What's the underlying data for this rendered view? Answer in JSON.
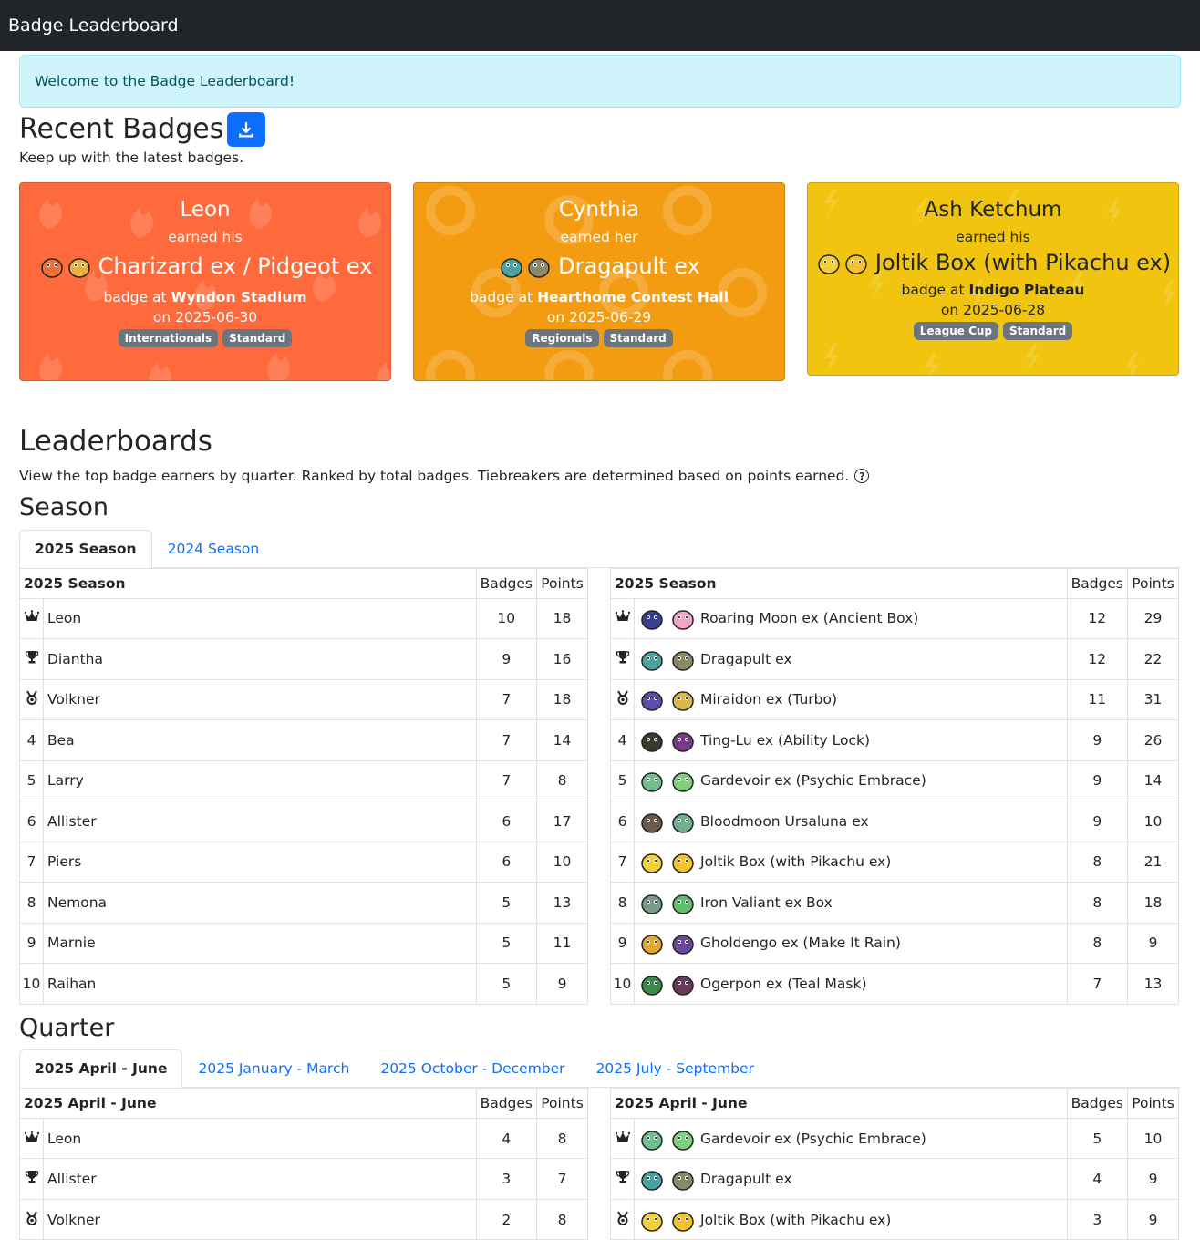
{
  "navbar": {
    "brand": "Badge Leaderboard"
  },
  "alert": {
    "text": "Welcome to the Badge Leaderboard!"
  },
  "recent": {
    "title": "Recent Badges",
    "subtitle": "Keep up with the latest badges.",
    "cards": [
      {
        "name": "Leon",
        "earned": "earned his",
        "deck": "Charizard ex / Pidgeot ex",
        "venue_prefix": "badge at",
        "venue": "Wyndon Stadium",
        "date": "on 2025-06-30",
        "tags": [
          "Internationals",
          "Standard"
        ],
        "color": "#ff6a3d"
      },
      {
        "name": "Cynthia",
        "earned": "earned her",
        "deck": "Dragapult ex",
        "venue_prefix": "badge at",
        "venue": "Hearthome Contest Hall",
        "date": "on 2025-06-29",
        "tags": [
          "Regionals",
          "Standard"
        ],
        "color": "#f39c12"
      },
      {
        "name": "Ash Ketchum",
        "earned": "earned his",
        "deck": "Joltik Box (with Pikachu ex)",
        "venue_prefix": "badge at",
        "venue": "Indigo Plateau",
        "date": "on 2025-06-28",
        "tags": [
          "League Cup",
          "Standard"
        ],
        "color": "#f1c40f"
      }
    ]
  },
  "leaderboards": {
    "title": "Leaderboards",
    "description": "View the top badge earners by quarter. Ranked by total badges. Tiebreakers are determined based on points earned.",
    "season": {
      "title": "Season",
      "tabs": [
        "2025 Season",
        "2024 Season"
      ],
      "player_table": {
        "header": "2025 Season",
        "col_badges": "Badges",
        "col_points": "Points",
        "rows": [
          {
            "rank": "crown",
            "name": "Leon",
            "badges": "10",
            "points": "18"
          },
          {
            "rank": "trophy",
            "name": "Diantha",
            "badges": "9",
            "points": "16"
          },
          {
            "rank": "medal",
            "name": "Volkner",
            "badges": "7",
            "points": "18"
          },
          {
            "rank": "4",
            "name": "Bea",
            "badges": "7",
            "points": "14"
          },
          {
            "rank": "5",
            "name": "Larry",
            "badges": "7",
            "points": "8"
          },
          {
            "rank": "6",
            "name": "Allister",
            "badges": "6",
            "points": "17"
          },
          {
            "rank": "7",
            "name": "Piers",
            "badges": "6",
            "points": "10"
          },
          {
            "rank": "8",
            "name": "Nemona",
            "badges": "5",
            "points": "13"
          },
          {
            "rank": "9",
            "name": "Marnie",
            "badges": "5",
            "points": "11"
          },
          {
            "rank": "10",
            "name": "Raihan",
            "badges": "5",
            "points": "9"
          }
        ]
      },
      "deck_table": {
        "header": "2025 Season",
        "col_badges": "Badges",
        "col_points": "Points",
        "rows": [
          {
            "rank": "crown",
            "name": "Roaring Moon ex (Ancient Box)",
            "badges": "12",
            "points": "29",
            "sprites": [
              "#3b3f8f",
              "#f3a6c8"
            ]
          },
          {
            "rank": "trophy",
            "name": "Dragapult ex",
            "badges": "12",
            "points": "22",
            "sprites": [
              "#4aa3a0",
              "#8a8a6a"
            ]
          },
          {
            "rank": "medal",
            "name": "Miraidon ex (Turbo)",
            "badges": "11",
            "points": "31",
            "sprites": [
              "#5a4fb0",
              "#d8b84a"
            ]
          },
          {
            "rank": "4",
            "name": "Ting-Lu ex (Ability Lock)",
            "badges": "9",
            "points": "26",
            "sprites": [
              "#3c3a2c",
              "#7a3a8a"
            ]
          },
          {
            "rank": "5",
            "name": "Gardevoir ex (Psychic Embrace)",
            "badges": "9",
            "points": "14",
            "sprites": [
              "#6fbf8f",
              "#7fcf7f"
            ]
          },
          {
            "rank": "6",
            "name": "Bloodmoon Ursaluna ex",
            "badges": "9",
            "points": "10",
            "sprites": [
              "#6b5a4a",
              "#6fb08f"
            ]
          },
          {
            "rank": "7",
            "name": "Joltik Box (with Pikachu ex)",
            "badges": "8",
            "points": "21",
            "sprites": [
              "#f2d03b",
              "#f2c230"
            ]
          },
          {
            "rank": "8",
            "name": "Iron Valiant ex Box",
            "badges": "8",
            "points": "18",
            "sprites": [
              "#7a9a8a",
              "#5fbf6f"
            ]
          },
          {
            "rank": "9",
            "name": "Gholdengo ex (Make It Rain)",
            "badges": "8",
            "points": "9",
            "sprites": [
              "#e0a830",
              "#6a4aa0"
            ]
          },
          {
            "rank": "10",
            "name": "Ogerpon ex (Teal Mask)",
            "badges": "7",
            "points": "13",
            "sprites": [
              "#3a8a4a",
              "#6a3a5a"
            ]
          }
        ]
      }
    },
    "quarter": {
      "title": "Quarter",
      "tabs": [
        "2025 April - June",
        "2025 January - March",
        "2025 October - December",
        "2025 July - September"
      ],
      "player_table": {
        "header": "2025 April - June",
        "col_badges": "Badges",
        "col_points": "Points",
        "rows": [
          {
            "rank": "crown",
            "name": "Leon",
            "badges": "4",
            "points": "8"
          },
          {
            "rank": "trophy",
            "name": "Allister",
            "badges": "3",
            "points": "7"
          },
          {
            "rank": "medal",
            "name": "Volkner",
            "badges": "2",
            "points": "8"
          }
        ]
      },
      "deck_table": {
        "header": "2025 April - June",
        "col_badges": "Badges",
        "col_points": "Points",
        "rows": [
          {
            "rank": "crown",
            "name": "Gardevoir ex (Psychic Embrace)",
            "badges": "5",
            "points": "10",
            "sprites": [
              "#6fbf8f",
              "#7fcf7f"
            ]
          },
          {
            "rank": "trophy",
            "name": "Dragapult ex",
            "badges": "4",
            "points": "9",
            "sprites": [
              "#4aa3a0",
              "#8a8a6a"
            ]
          },
          {
            "rank": "medal",
            "name": "Joltik Box (with Pikachu ex)",
            "badges": "3",
            "points": "9",
            "sprites": [
              "#f2d03b",
              "#f2c230"
            ]
          }
        ]
      }
    }
  }
}
